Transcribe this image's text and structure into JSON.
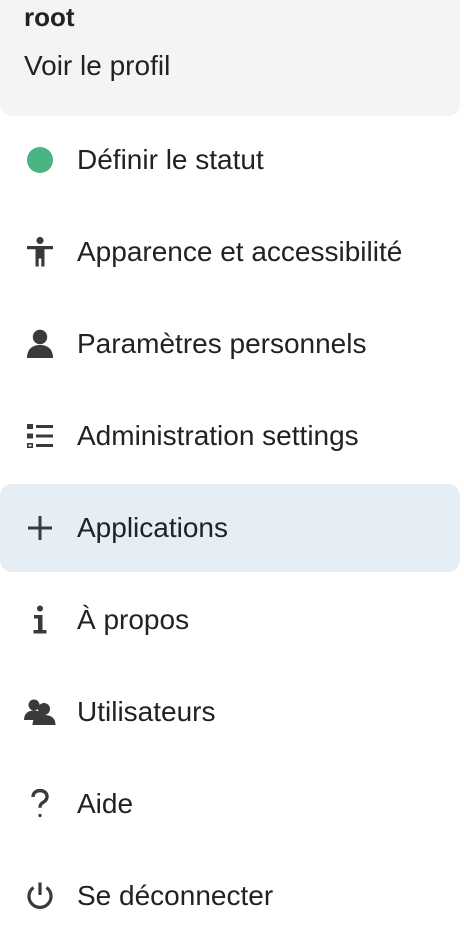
{
  "profile": {
    "username": "root",
    "view_profile": "Voir le profil"
  },
  "colors": {
    "status_online": "#49b382",
    "active_background": "#e5eef5",
    "icon": "#3a3a3a"
  },
  "menu": {
    "items": [
      {
        "label": "Définir le statut",
        "icon": "status-dot-icon"
      },
      {
        "label": "Apparence et accessibilité",
        "icon": "accessibility-icon"
      },
      {
        "label": "Paramètres personnels",
        "icon": "user-icon"
      },
      {
        "label": "Administration settings",
        "icon": "checklist-icon"
      },
      {
        "label": "Applications",
        "icon": "plus-icon",
        "active": true
      },
      {
        "label": "À propos",
        "icon": "info-icon"
      },
      {
        "label": "Utilisateurs",
        "icon": "users-icon"
      },
      {
        "label": "Aide",
        "icon": "help-icon"
      },
      {
        "label": "Se déconnecter",
        "icon": "power-icon"
      }
    ]
  }
}
